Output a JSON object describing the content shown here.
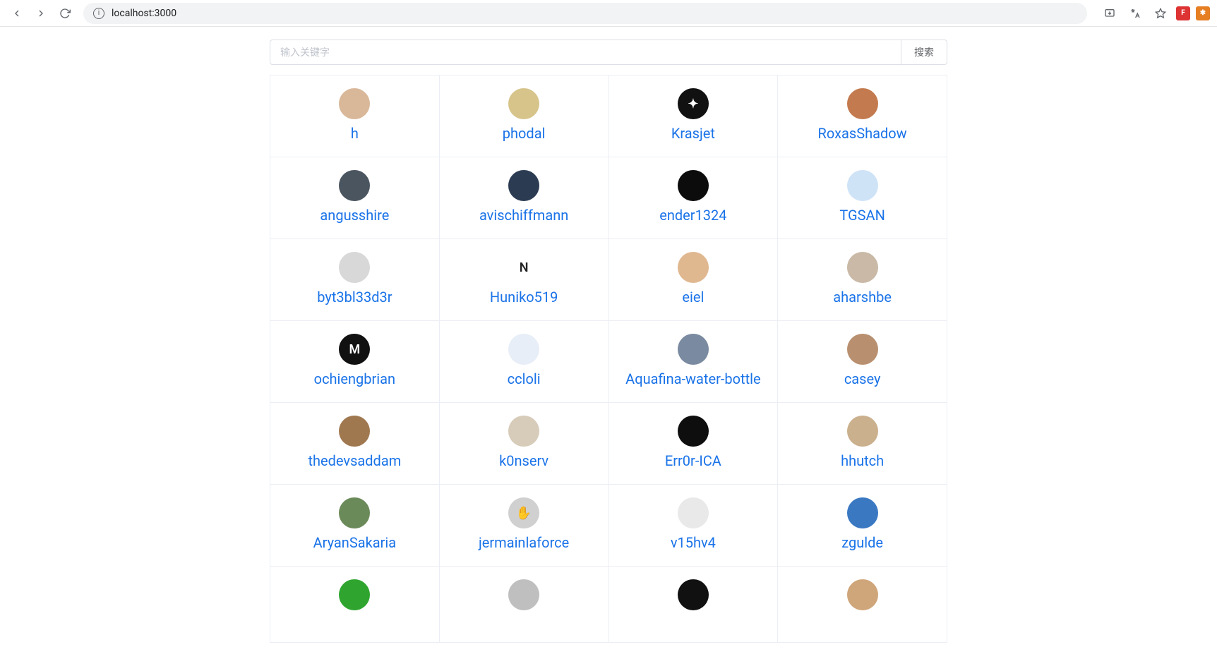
{
  "browser": {
    "url": "localhost:3000"
  },
  "search": {
    "placeholder": "输入关键字",
    "button_label": "搜索"
  },
  "users": [
    {
      "name": "h",
      "avatar_bg": "#d9b89a",
      "avatar_initial": ""
    },
    {
      "name": "phodal",
      "avatar_bg": "#d6c48a",
      "avatar_initial": ""
    },
    {
      "name": "Krasjet",
      "avatar_bg": "#111111",
      "avatar_initial": "✦"
    },
    {
      "name": "RoxasShadow",
      "avatar_bg": "#c37a4e",
      "avatar_initial": ""
    },
    {
      "name": "angusshire",
      "avatar_bg": "#4a5560",
      "avatar_initial": ""
    },
    {
      "name": "avischiffmann",
      "avatar_bg": "#2b3b52",
      "avatar_initial": ""
    },
    {
      "name": "ender1324",
      "avatar_bg": "#0c0c0c",
      "avatar_initial": ""
    },
    {
      "name": "TGSAN",
      "avatar_bg": "#cfe3f7",
      "avatar_initial": ""
    },
    {
      "name": "byt3bl33d3r",
      "avatar_bg": "#d8d8d8",
      "avatar_initial": ""
    },
    {
      "name": "Huniko519",
      "avatar_bg": "#ffffff",
      "avatar_initial": "N"
    },
    {
      "name": "eiel",
      "avatar_bg": "#e0b890",
      "avatar_initial": ""
    },
    {
      "name": "aharshbe",
      "avatar_bg": "#c9b9a6",
      "avatar_initial": ""
    },
    {
      "name": "ochiengbrian",
      "avatar_bg": "#111111",
      "avatar_initial": "M"
    },
    {
      "name": "ccloli",
      "avatar_bg": "#e8eef7",
      "avatar_initial": ""
    },
    {
      "name": "Aquafina-water-bottle",
      "avatar_bg": "#7a8aa0",
      "avatar_initial": ""
    },
    {
      "name": "casey",
      "avatar_bg": "#b89070",
      "avatar_initial": ""
    },
    {
      "name": "thedevsaddam",
      "avatar_bg": "#a07850",
      "avatar_initial": ""
    },
    {
      "name": "k0nserv",
      "avatar_bg": "#d7cbb9",
      "avatar_initial": ""
    },
    {
      "name": "Err0r-ICA",
      "avatar_bg": "#0e0e0e",
      "avatar_initial": ""
    },
    {
      "name": "hhutch",
      "avatar_bg": "#cbb08e",
      "avatar_initial": ""
    },
    {
      "name": "AryanSakaria",
      "avatar_bg": "#6b8a5a",
      "avatar_initial": ""
    },
    {
      "name": "jermainlaforce",
      "avatar_bg": "#d0d0d0",
      "avatar_initial": "✋"
    },
    {
      "name": "v15hv4",
      "avatar_bg": "#e9e9e9",
      "avatar_initial": ""
    },
    {
      "name": "zgulde",
      "avatar_bg": "#3a78c2",
      "avatar_initial": ""
    },
    {
      "name": "",
      "avatar_bg": "#2fa52f",
      "avatar_initial": ""
    },
    {
      "name": "",
      "avatar_bg": "#bfbfbf",
      "avatar_initial": ""
    },
    {
      "name": "",
      "avatar_bg": "#111111",
      "avatar_initial": ""
    },
    {
      "name": "",
      "avatar_bg": "#cfa57a",
      "avatar_initial": ""
    }
  ]
}
